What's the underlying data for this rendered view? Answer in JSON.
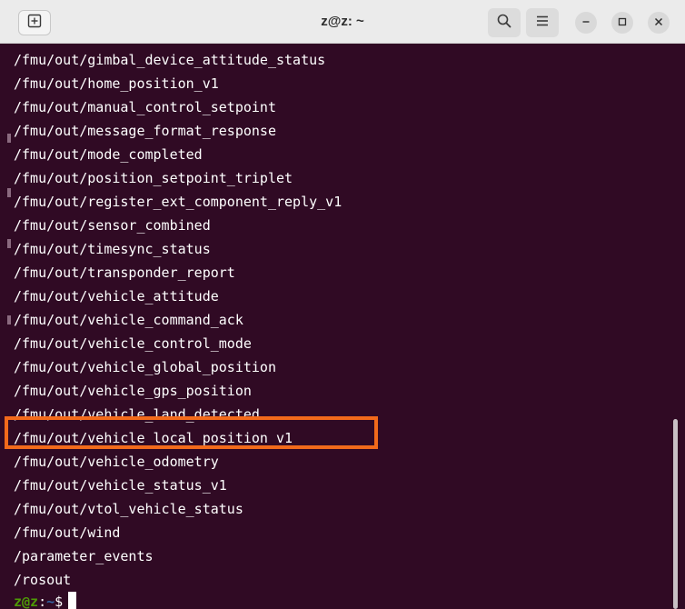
{
  "window": {
    "title": "z@z: ~"
  },
  "titlebar": {
    "buttons": [
      {
        "name": "new-tab",
        "icon": "new-tab-icon"
      },
      {
        "name": "search",
        "icon": "search-icon"
      },
      {
        "name": "menu",
        "icon": "hamburger-menu-icon"
      },
      {
        "name": "minimize",
        "icon": "minimize-icon"
      },
      {
        "name": "maximize",
        "icon": "maximize-icon"
      },
      {
        "name": "close",
        "icon": "close-icon"
      }
    ]
  },
  "terminal": {
    "lines": [
      "/fmu/out/gimbal_device_attitude_status",
      "/fmu/out/home_position_v1",
      "/fmu/out/manual_control_setpoint",
      "/fmu/out/message_format_response",
      "/fmu/out/mode_completed",
      "/fmu/out/position_setpoint_triplet",
      "/fmu/out/register_ext_component_reply_v1",
      "/fmu/out/sensor_combined",
      "/fmu/out/timesync_status",
      "/fmu/out/transponder_report",
      "/fmu/out/vehicle_attitude",
      "/fmu/out/vehicle_command_ack",
      "/fmu/out/vehicle_control_mode",
      "/fmu/out/vehicle_global_position",
      "/fmu/out/vehicle_gps_position",
      "/fmu/out/vehicle_land_detected",
      "/fmu/out/vehicle_local_position_v1",
      "/fmu/out/vehicle_odometry",
      "/fmu/out/vehicle_status_v1",
      "/fmu/out/vtol_vehicle_status",
      "/fmu/out/wind",
      "/parameter_events",
      "/rosout"
    ],
    "highlighted_line": "/fmu/out/vehicle_local_position_v1",
    "prompt": {
      "user_host": "z@z",
      "colon": ":",
      "dir": "~",
      "symbol": "$"
    }
  },
  "colors": {
    "terminal_bg": "#300a24",
    "terminal_fg": "#ffffff",
    "prompt_user": "#4e9a06",
    "prompt_dir": "#3465a4",
    "highlight_border": "#f26a1b",
    "titlebar_bg": "#ebebeb"
  }
}
